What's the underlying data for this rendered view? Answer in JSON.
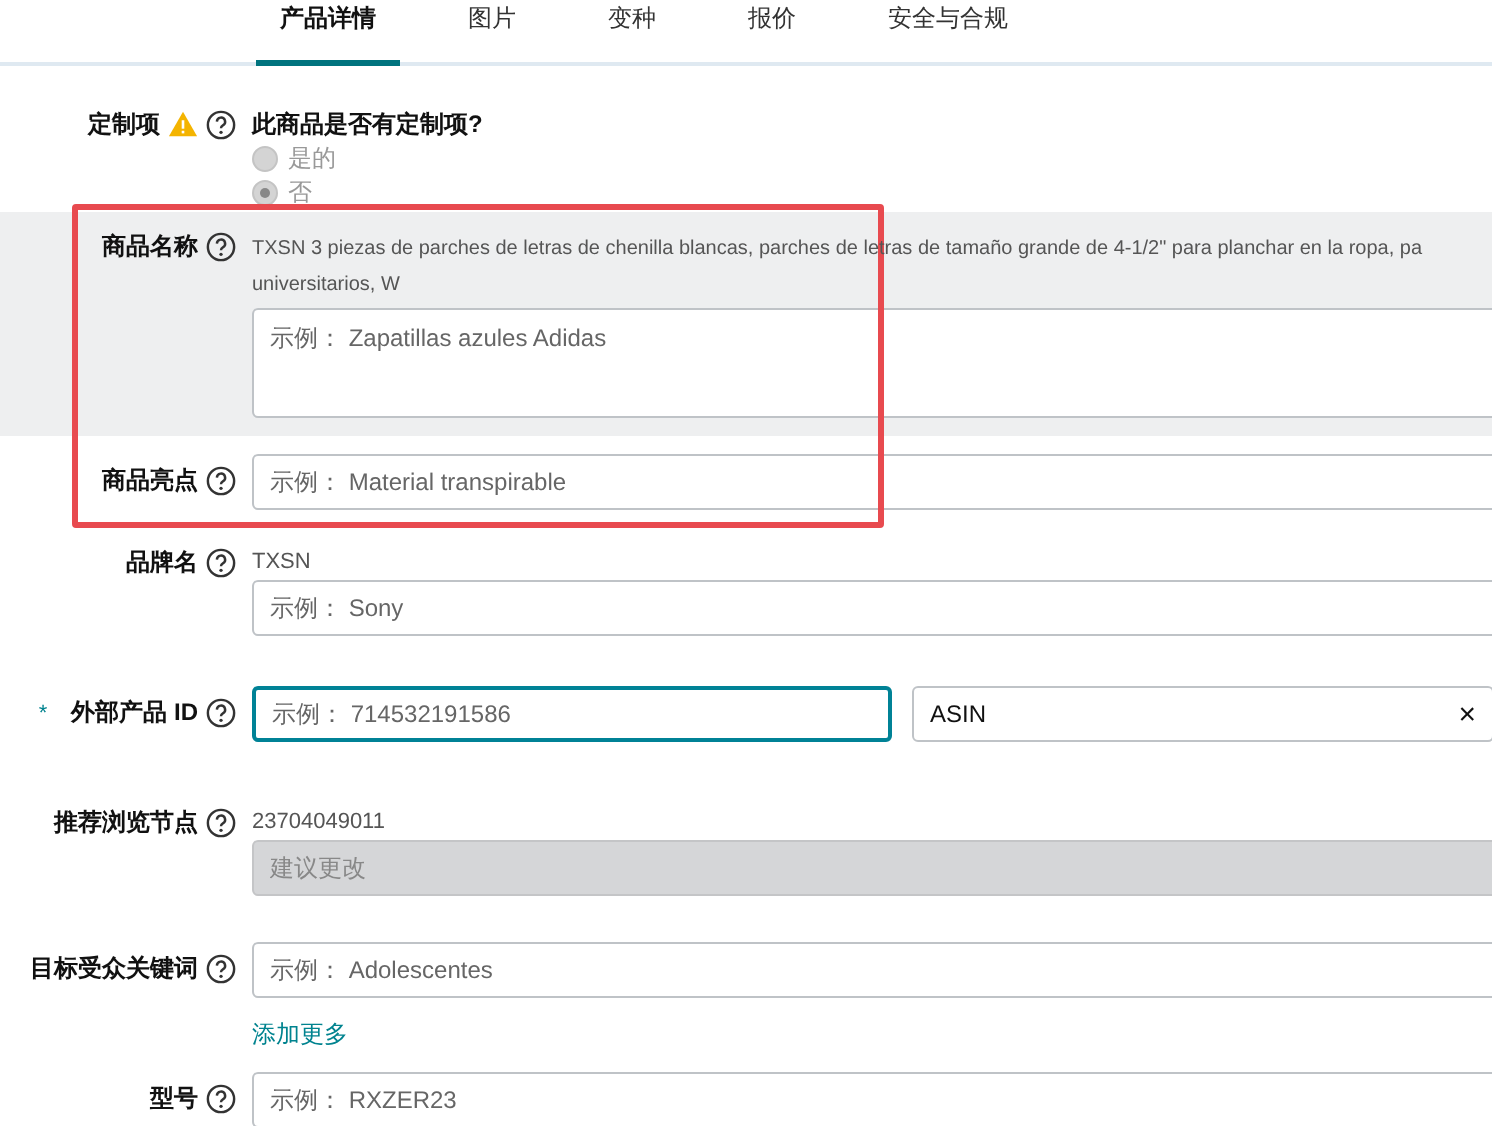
{
  "tabs": [
    {
      "label": "产品详情",
      "selected": true
    },
    {
      "label": "图片",
      "selected": false
    },
    {
      "label": "变种",
      "selected": false
    },
    {
      "label": "报价",
      "selected": false
    },
    {
      "label": "安全与合规",
      "selected": false
    }
  ],
  "fields": [
    {
      "kind": "radio",
      "label": "定制项",
      "warning": true,
      "question": "此商品是否有定制项?",
      "options": [
        {
          "label": "是的",
          "selected": false
        },
        {
          "label": "否",
          "selected": true
        }
      ]
    },
    {
      "kind": "textarea",
      "label": "商品名称",
      "shaded": true,
      "current_lines": [
        "TXSN 3 piezas de parches de letras de chenilla blancas, parches de letras de tamaño grande de 4-1/2\" para planchar en la ropa, pa",
        "universitarios, W"
      ],
      "placeholder": "示例： Zapatillas azules Adidas"
    },
    {
      "kind": "input",
      "label": "商品亮点",
      "placeholder": "示例： Material transpirable"
    },
    {
      "kind": "input",
      "label": "品牌名",
      "current": "TXSN",
      "placeholder": "示例： Sony"
    },
    {
      "kind": "id",
      "label": "外部产品 ID",
      "required": "*",
      "focused": true,
      "placeholder": "示例： 714532191586",
      "id_type": "ASIN",
      "clear": "×"
    },
    {
      "kind": "input",
      "label": "推荐浏览节点",
      "current": "23704049011",
      "disabled": true,
      "placeholder": "建议更改"
    },
    {
      "kind": "input",
      "label": "目标受众关键词",
      "placeholder": "示例： Adolescentes",
      "add_more": "添加更多"
    },
    {
      "kind": "input",
      "label": "型号",
      "placeholder": "示例： RXZER23"
    }
  ]
}
